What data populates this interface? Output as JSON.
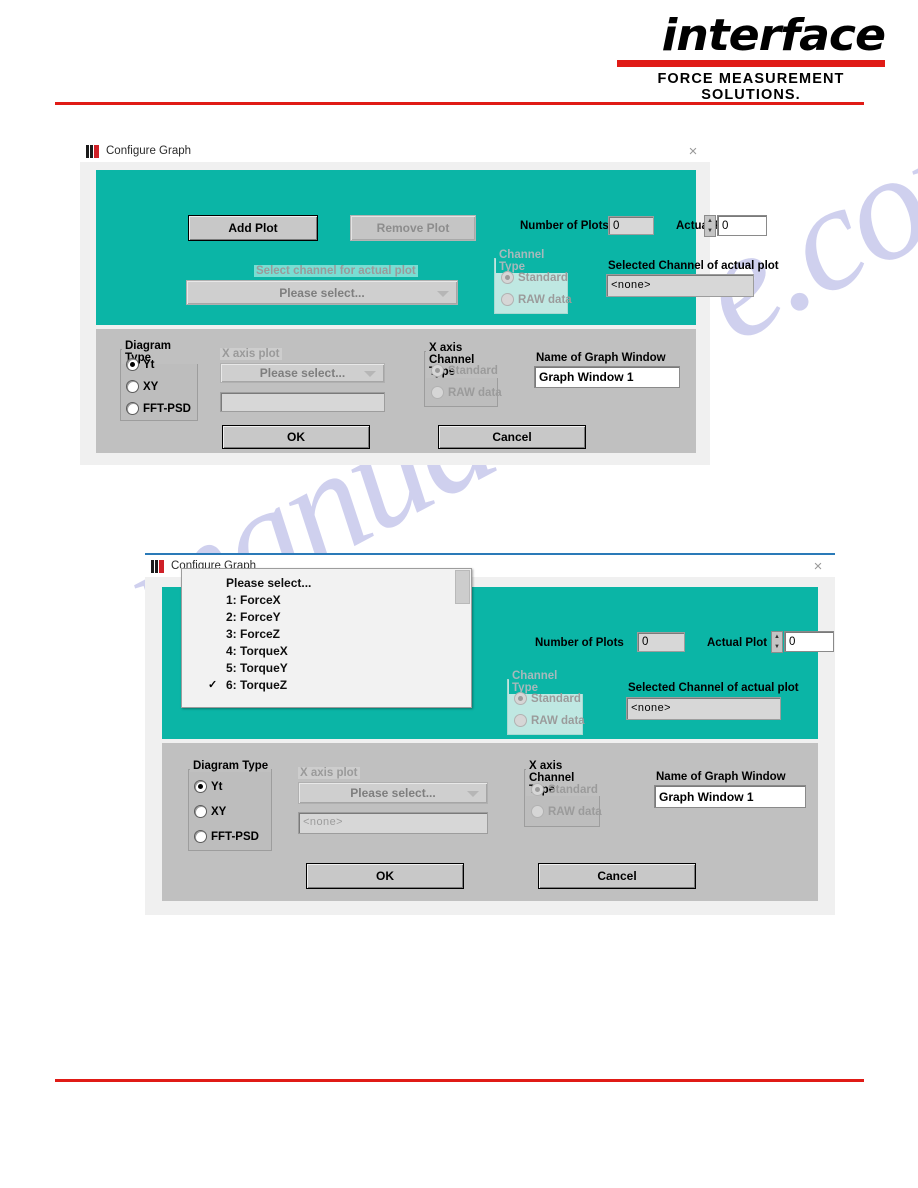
{
  "brand": {
    "wordmark": "interface",
    "tagline": "FORCE MEASUREMENT SOLUTIONS.",
    "accent_red": "#e01b16"
  },
  "watermark": {
    "text": "manualshive.com"
  },
  "colors": {
    "teal_panel": "#0bb5a6",
    "gray_panel": "#c0c0c0",
    "dialog_face": "#f0f0f0"
  },
  "dialog1": {
    "title": "Configure Graph",
    "close_label": "×",
    "add_plot": "Add Plot",
    "remove_plot": "Remove Plot",
    "number_of_plots_label": "Number of Plots",
    "number_of_plots_value": "0",
    "actual_plot_label": "Actual Plot",
    "actual_plot_value": "0",
    "select_channel_label": "Select channel for actual plot",
    "select_channel_value": "Please select...",
    "channel_type_caption": "Channel Type",
    "channel_type_standard": "Standard",
    "channel_type_raw": "RAW data",
    "selected_channel_label": "Selected Channel of actual plot",
    "selected_channel_value": "<none>",
    "diagram_type_caption": "Diagram Type",
    "diagram_yt": "Yt",
    "diagram_xy": "XY",
    "diagram_fft": "FFT-PSD",
    "x_axis_plot_label": "X axis plot",
    "x_axis_plot_value": "Please select...",
    "x_axis_channel_value": "",
    "x_axis_channel_type_caption": "X axis Channel Type",
    "x_axis_standard": "Standard",
    "x_axis_raw": "RAW data",
    "name_of_graph_window_label": "Name of Graph Window",
    "name_of_graph_window_value": "Graph Window 1",
    "ok": "OK",
    "cancel": "Cancel"
  },
  "dialog2": {
    "title": "Configure Graph",
    "close_label": "×",
    "number_of_plots_label": "Number of Plots",
    "number_of_plots_value": "0",
    "actual_plot_label": "Actual Plot",
    "actual_plot_value": "0",
    "channel_type_caption": "Channel Type",
    "channel_type_standard": "Standard",
    "channel_type_raw": "RAW data",
    "selected_channel_label": "Selected Channel of actual plot",
    "selected_channel_value": "<none>",
    "diagram_type_caption": "Diagram Type",
    "diagram_yt": "Yt",
    "diagram_xy": "XY",
    "diagram_fft": "FFT-PSD",
    "x_axis_plot_label": "X axis plot",
    "x_axis_plot_value": "Please select...",
    "x_axis_channel_value": "<none>",
    "x_axis_channel_type_caption": "X axis Channel Type",
    "x_axis_standard": "Standard",
    "x_axis_raw": "RAW data",
    "name_of_graph_window_label": "Name of Graph Window",
    "name_of_graph_window_value": "Graph Window 1",
    "ok": "OK",
    "cancel": "Cancel",
    "dropdown": {
      "checkmark": "✓",
      "selected_index": 6,
      "items": [
        "Please select...",
        "1: ForceX",
        "2: ForceY",
        "3: ForceZ",
        "4: TorqueX",
        "5: TorqueY",
        "6: TorqueZ"
      ]
    }
  }
}
